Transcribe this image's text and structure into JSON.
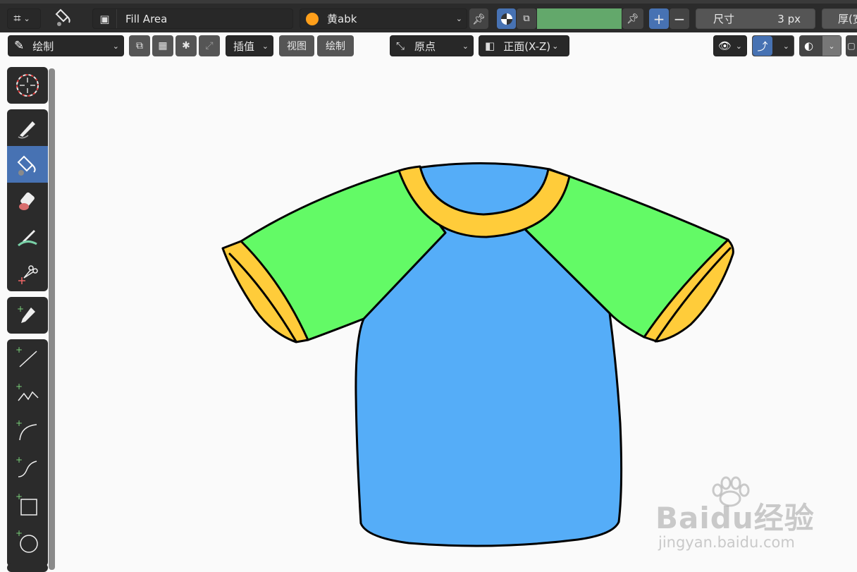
{
  "header": {
    "mode_icon": "grease-pencil-mode-icon",
    "fill_tool_icon": "fill-bucket-icon",
    "brush_name": "Fill Area",
    "material_name": "黄abk",
    "material_color": "#ff9f1a",
    "fill_color": "#63a86b",
    "size_label": "尺寸",
    "size_value": "3 px",
    "thickness_label": "厚(宽"
  },
  "header2": {
    "mode_label": "绘制",
    "interpolate_label": "插值",
    "view_menu": "视图",
    "draw_menu": "绘制",
    "origin_label": "原点",
    "plane_label": "正面(X-Z)"
  },
  "toolbar": {
    "tools": [
      "cursor-icon",
      "draw-icon",
      "fill-icon",
      "erase-icon",
      "tint-icon",
      "cutter-icon",
      "eyedropper-icon",
      "line-icon",
      "polyline-icon",
      "arc-icon",
      "curve-icon",
      "box-icon",
      "circle-icon"
    ],
    "active_tool": "fill-icon"
  },
  "colors": {
    "shirt_body": "#55adf8",
    "sleeves": "#63fa66",
    "trim": "#ffcc3a",
    "outline": "#000000"
  },
  "watermark": {
    "brand": "Baidu经验",
    "url": "jingyan.baidu.com"
  }
}
